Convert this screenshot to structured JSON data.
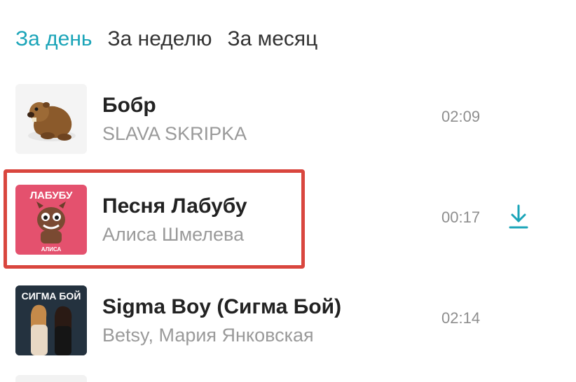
{
  "tabs": [
    {
      "label": "За день",
      "active": true
    },
    {
      "label": "За неделю",
      "active": false
    },
    {
      "label": "За месяц",
      "active": false
    }
  ],
  "tracks": [
    {
      "title": "Бобр",
      "artist": "SLAVA SKRIPKA",
      "duration": "02:09",
      "cover_icon": "beaver-icon",
      "downloadable": false
    },
    {
      "title": "Песня Лабубу",
      "artist": "Алиса Шмелева",
      "duration": "00:17",
      "cover_icon": "labubu-cover",
      "cover_text_top": "ЛАБУБУ",
      "cover_text_bottom": "АЛИСА",
      "downloadable": true,
      "download_icon": "download-icon",
      "highlighted": true
    },
    {
      "title": "Sigma Boy (Сигма Бой)",
      "artist": "Betsy, Мария Янковская",
      "duration": "02:14",
      "cover_icon": "sigma-boy-cover",
      "cover_text_top": "СИГМА БОЙ",
      "downloadable": false
    }
  ],
  "colors": {
    "accent": "#1aa4b8",
    "highlight_border": "#d9463e",
    "title_text": "#222222",
    "artist_text": "#9a9a9a",
    "duration_text": "#8e8e8e"
  }
}
